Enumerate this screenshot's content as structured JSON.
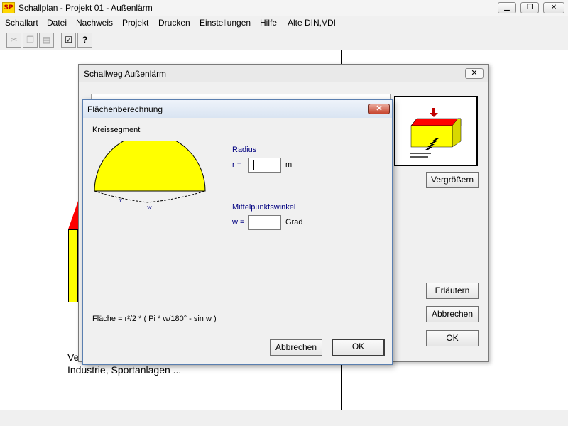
{
  "window": {
    "title": "Schallplan   - Projekt 01 - Außenlärm",
    "logo": "SP",
    "buttons": {
      "minimize_icon": "minimize-icon",
      "restore_icon": "restore-icon",
      "close_icon": "close-icon"
    }
  },
  "menu": {
    "items": [
      "Schallart",
      "Datei",
      "Nachweis",
      "Projekt",
      "Drucken",
      "Einstellungen",
      "Hilfe",
      "Alte DIN,VDI"
    ]
  },
  "toolbar": {
    "items": [
      {
        "icon": "cut-icon",
        "glyph": "✂",
        "enabled": false
      },
      {
        "icon": "copy-icon",
        "glyph": "❐",
        "enabled": false
      },
      {
        "icon": "paste-icon",
        "glyph": "▤",
        "enabled": false
      },
      {
        "icon": "properties-icon",
        "glyph": "☑",
        "enabled": true
      },
      {
        "icon": "context-help-icon",
        "glyph": "?",
        "enabled": true
      }
    ]
  },
  "background": {
    "text_line1": "Ve",
    "text_line2": "Industrie, Sportanlagen ..."
  },
  "schallweg_dialog": {
    "title": "Schallweg Außenlärm",
    "close_icon": "close-icon",
    "vergroessern_label": "Vergrößern",
    "erlaeutern_label": "Erläutern",
    "abbrechen_label": "Abbrechen",
    "ok_label": "OK"
  },
  "flaeche_dialog": {
    "title": "Flächenberechnung",
    "close_glyph": "✕",
    "shape_label": "Kreissegment",
    "diagram_r_label": "r",
    "diagram_w_label": "w",
    "radius_heading": "Radius",
    "r_label": "r =",
    "r_value": "",
    "r_unit": "m",
    "angle_heading": "Mittelpunktswinkel",
    "w_label": "w =",
    "w_value": "",
    "w_unit": "Grad",
    "formula": "Fläche = r²/2 * ( Pi * w/180° - sin w )",
    "abbrechen_label": "Abbrechen",
    "ok_label": "OK"
  },
  "colors": {
    "segment_fill": "#ffff00",
    "roof_red": "#ff0000",
    "label_blue": "#000080",
    "close_red": "#c7452f"
  }
}
